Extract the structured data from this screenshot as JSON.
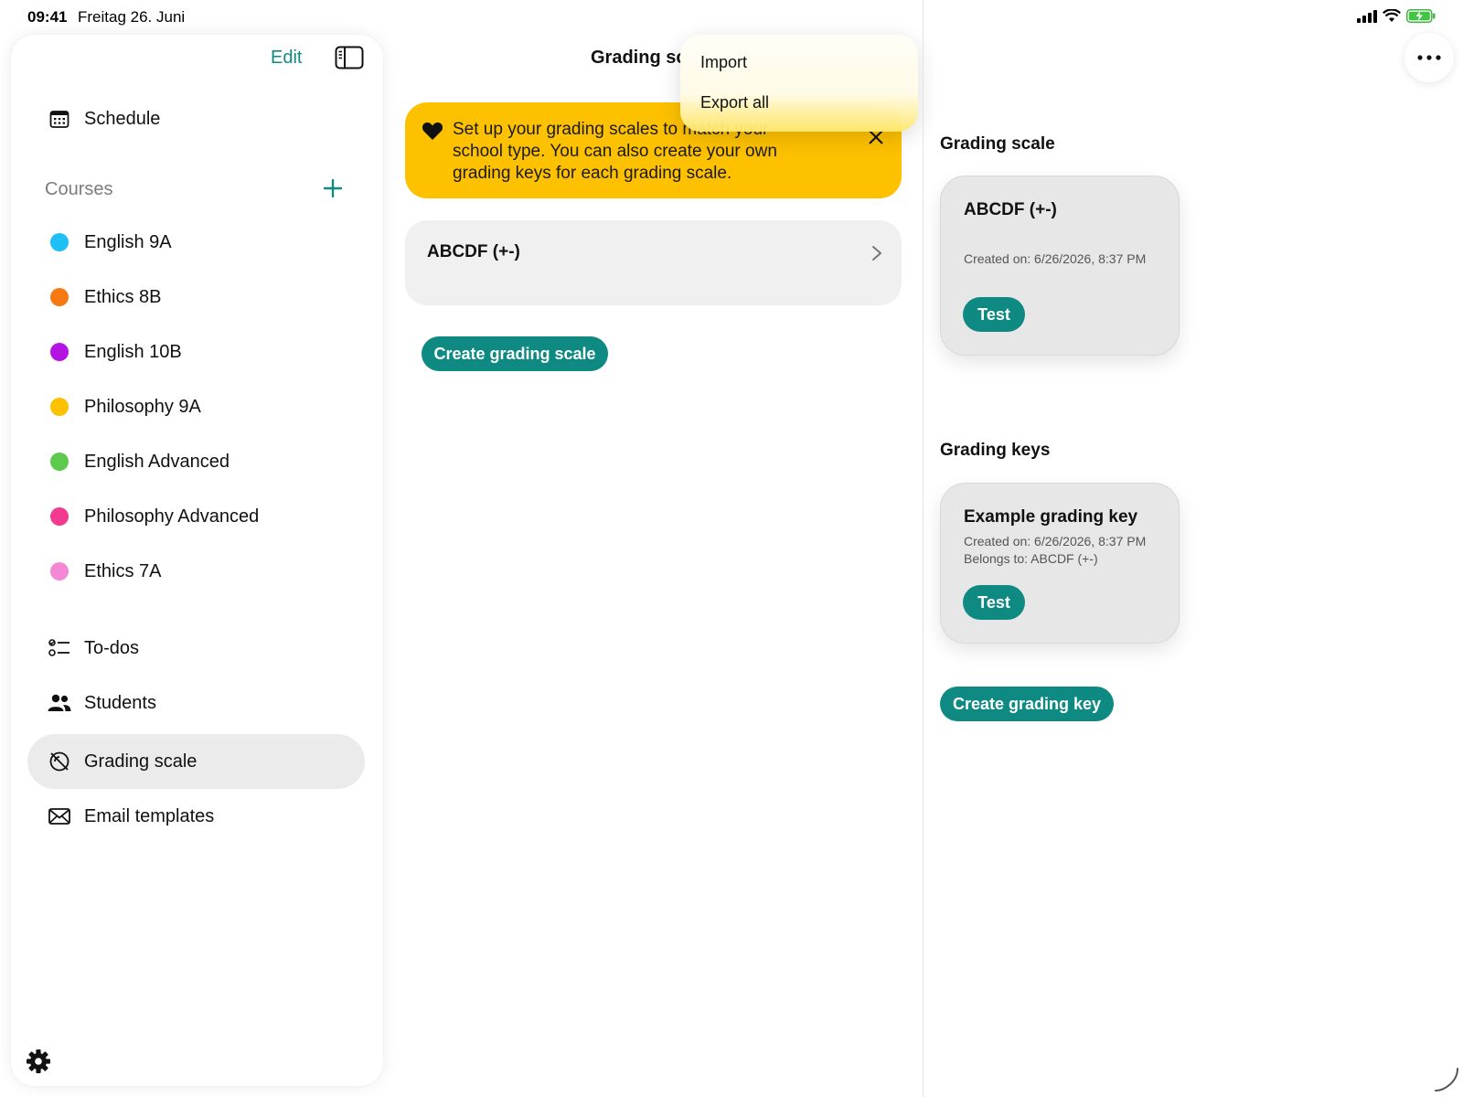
{
  "status_bar": {
    "time": "09:41",
    "date": "Freitag 26. Juni",
    "icons": [
      "signal-icon",
      "wifi-icon",
      "battery-charging-icon"
    ]
  },
  "sidebar": {
    "edit_label": "Edit",
    "schedule_label": "Schedule",
    "courses_label": "Courses",
    "courses": [
      {
        "label": "English 9A",
        "color": "#1cc0f5"
      },
      {
        "label": "Ethics 8B",
        "color": "#f57a12"
      },
      {
        "label": "English 10B",
        "color": "#b513e3"
      },
      {
        "label": "Philosophy 9A",
        "color": "#fdc100"
      },
      {
        "label": "English Advanced",
        "color": "#5ccb4c"
      },
      {
        "label": "Philosophy Advanced",
        "color": "#f23b8e"
      },
      {
        "label": "Ethics 7A",
        "color": "#f588d6"
      }
    ],
    "nav": [
      {
        "label": "To-dos",
        "icon": "todos-icon"
      },
      {
        "label": "Students",
        "icon": "students-icon"
      },
      {
        "label": "Grading scale",
        "icon": "grading-scale-icon",
        "active": true
      },
      {
        "label": "Email templates",
        "icon": "envelope-icon"
      }
    ]
  },
  "middle": {
    "title": "Grading scale",
    "banner_text": "Set up your grading scales to match your school type. You can also create your own grading keys for each grading scale.",
    "scale_items": [
      "ABCDF (+-)"
    ],
    "create_button": "Create grading scale"
  },
  "menu": {
    "items": [
      "Import",
      "Export all"
    ]
  },
  "detail": {
    "scale_heading": "Grading scale",
    "scale_card": {
      "title": "ABCDF (+-)",
      "created": "Created on: 6/26/2026, 8:37 PM",
      "button": "Test"
    },
    "keys_heading": "Grading keys",
    "key_card": {
      "title": "Example grading key",
      "created": "Created on: 6/26/2026, 8:37 PM",
      "belongs": "Belongs to: ABCDF (+-)",
      "button": "Test"
    },
    "create_key_button": "Create grading key"
  },
  "colors": {
    "accent": "#0f8a83",
    "banner": "#fdc100",
    "active_row": "#ebebeb"
  }
}
